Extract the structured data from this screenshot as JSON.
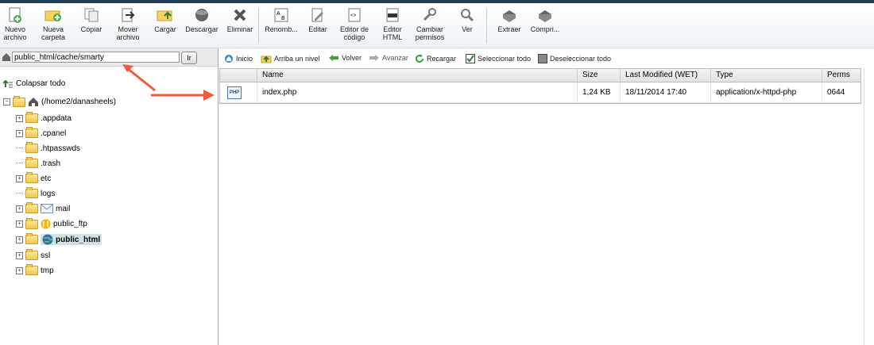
{
  "toolbar": {
    "buttons": [
      {
        "label": "Nuevo\narchivo",
        "icon": "new-file-icon"
      },
      {
        "label": "Nueva\ncarpeta",
        "icon": "new-folder-icon"
      },
      {
        "label": "Copiar",
        "icon": "copy-icon"
      },
      {
        "label": "Mover\narchivo",
        "icon": "move-file-icon"
      },
      {
        "label": "Cargar",
        "icon": "upload-icon"
      },
      {
        "label": "Descargar",
        "icon": "download-icon"
      },
      {
        "label": "Eliminar",
        "icon": "delete-icon"
      },
      {
        "label": "Renomb...",
        "icon": "rename-icon"
      },
      {
        "label": "Editar",
        "icon": "edit-icon"
      },
      {
        "label": "Editor de\ncódigo",
        "icon": "code-editor-icon"
      },
      {
        "label": "Editor\nHTML",
        "icon": "html-editor-icon"
      },
      {
        "label": "Cambiar\npermisos",
        "icon": "permissions-icon"
      },
      {
        "label": "Ver",
        "icon": "view-icon"
      },
      {
        "label": "Extraer",
        "icon": "extract-icon"
      },
      {
        "label": "Compri...",
        "icon": "compress-icon"
      }
    ]
  },
  "path": {
    "value": "public_html/cache/smarty",
    "go_label": "Ir"
  },
  "nav": {
    "home": "Inicio",
    "up": "Arriba un nivel",
    "back": "Volver",
    "forward": "Avanzar",
    "reload": "Recargar",
    "select_all": "Seleccionar todo",
    "deselect_all": "Deseleccionar todo"
  },
  "tree": {
    "collapse_label": "Colapsar todo",
    "root": "(/home2/danasheels)",
    "items": [
      ".appdata",
      ".cpanel",
      ".htpasswds",
      ".trash",
      "etc",
      "logs",
      "mail",
      "public_ftp",
      "public_html",
      "ssl",
      "tmp"
    ],
    "selected": "public_html"
  },
  "table": {
    "headers": [
      "Name",
      "Size",
      "Last Modified (WET)",
      "Type",
      "Perms"
    ],
    "rows": [
      {
        "name": "index.php",
        "size": "1,24 KB",
        "modified": "18/11/2014 17:40",
        "type": "application/x-httpd-php",
        "perms": "0644"
      }
    ]
  },
  "colors": {
    "arrow": "#f05a3c",
    "selected_bg": "#cfe4e6",
    "topline": "#1f3f5a"
  }
}
